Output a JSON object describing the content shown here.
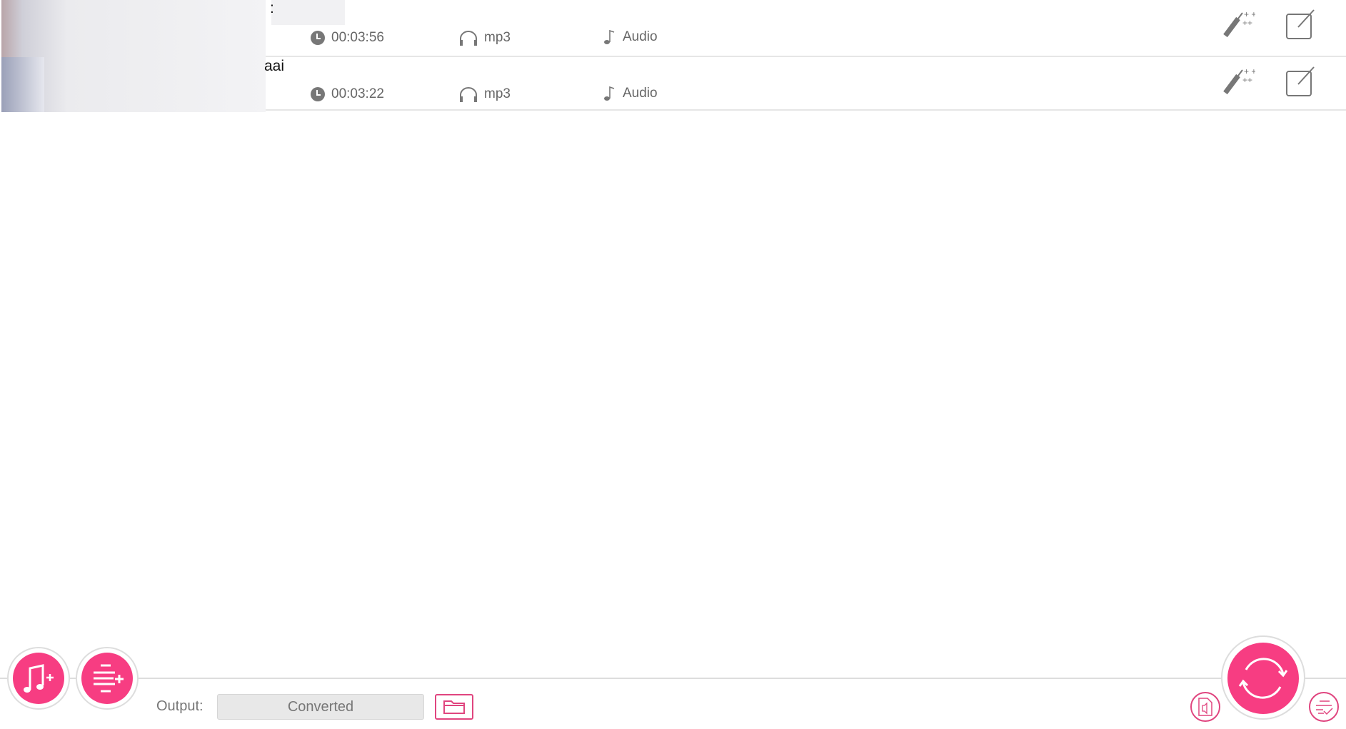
{
  "files": [
    {
      "title": ":",
      "duration": "00:03:56",
      "format": "mp3",
      "type": "Audio"
    },
    {
      "title": "aai",
      "duration": "00:03:22",
      "format": "mp3",
      "type": "Audio"
    }
  ],
  "icons": {
    "duration": "clock-icon",
    "format": "headphones-icon",
    "type": "music-note-icon",
    "effects": "magic-wand-icon",
    "edit": "edit-icon"
  },
  "toolbar": {
    "add_music": "add-music",
    "add_playlist": "add-playlist",
    "output_label": "Output:",
    "output_value": "Converted",
    "folder": "folder-icon",
    "convert": "convert",
    "audio_settings": "audio-file",
    "task_list": "task-list"
  },
  "colors": {
    "accent": "#f73d82",
    "text": "#666666"
  }
}
